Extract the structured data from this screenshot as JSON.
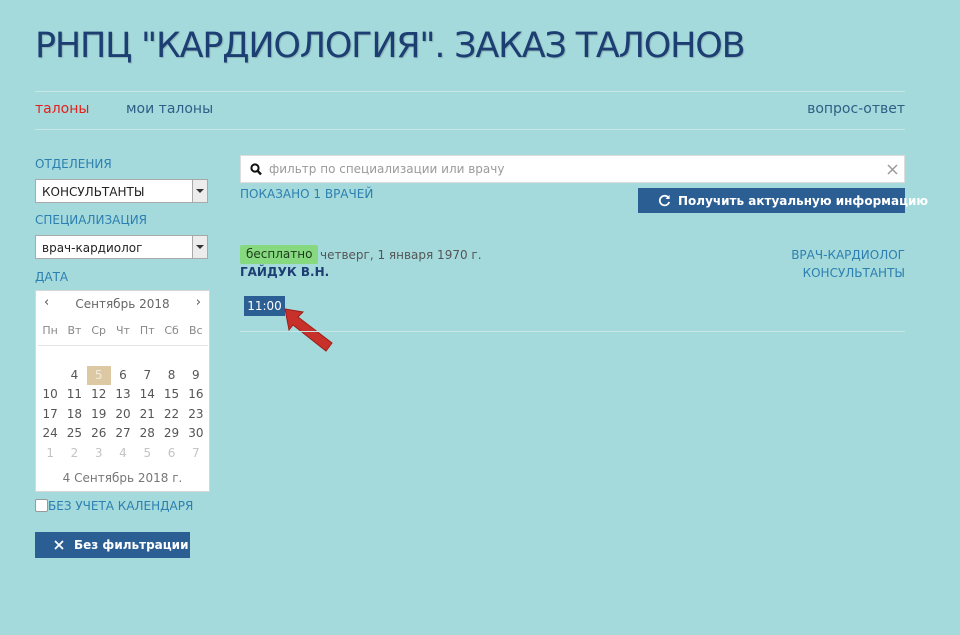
{
  "header": {
    "title": "РНПЦ \"КАРДИОЛОГИЯ\". ЗАКАЗ ТАЛОНОВ"
  },
  "nav": {
    "tickets": "талоны",
    "my_tickets": "мои талоны",
    "faq": "вопрос-ответ"
  },
  "colors": {
    "background": "#a5dadc",
    "title": "#1d3e73",
    "active_nav": "#e2211c",
    "label_blue": "#2c7fb0",
    "button_dark": "#2b5f94",
    "badge_green": "#86d97f",
    "arrow_red": "#c8302a"
  },
  "sidebar": {
    "department_label": "ОТДЕЛЕНИЯ",
    "department_value": "КОНСУЛЬТАНТЫ",
    "specialization_label": "СПЕЦИАЛИЗАЦИЯ",
    "specialization_value": "врач-кардиолог",
    "date_label": "ДАТА",
    "calendar": {
      "prev": "‹",
      "next": "›",
      "month": "Сентябрь 2018",
      "weekdays": [
        "Пн",
        "Вт",
        "Ср",
        "Чт",
        "Пт",
        "Сб",
        "Вс"
      ],
      "weeks": [
        [
          "",
          "",
          "",
          "",
          "",
          "",
          ""
        ],
        [
          "",
          "4",
          "5",
          "6",
          "7",
          "8",
          "9"
        ],
        [
          "10",
          "11",
          "12",
          "13",
          "14",
          "15",
          "16"
        ],
        [
          "17",
          "18",
          "19",
          "20",
          "21",
          "22",
          "23"
        ],
        [
          "24",
          "25",
          "26",
          "27",
          "28",
          "29",
          "30"
        ],
        [
          "1",
          "2",
          "3",
          "4",
          "5",
          "6",
          "7"
        ]
      ],
      "selected_day": "5",
      "footer": "4 Сентябрь 2018 г."
    },
    "ignore_calendar_label": "БЕЗ УЧЕТА КАЛЕНДАРЯ",
    "ignore_calendar_checked": false,
    "no_filter_button": "Без фильтрации",
    "no_filter_icon": "close-icon"
  },
  "main": {
    "search_placeholder": "фильтр по специализации или врачу",
    "search_value": "",
    "search_icon": "search-icon",
    "clear_icon": "close-icon",
    "shown_count": "ПОКАЗАНО 1 ВРАЧЕЙ",
    "refresh_button": "Получить актуальную информацию",
    "refresh_icon": "refresh-icon",
    "result": {
      "badge": "бесплатно",
      "date": "четверг, 1 января 1970 г.",
      "doctor": "ГАЙДУК В.Н.",
      "specialization": "ВРАЧ-КАРДИОЛОГ",
      "department": "КОНСУЛЬТАНТЫ",
      "time_slot": "11:00"
    },
    "annotation_icon": "arrow-pointer-icon"
  }
}
